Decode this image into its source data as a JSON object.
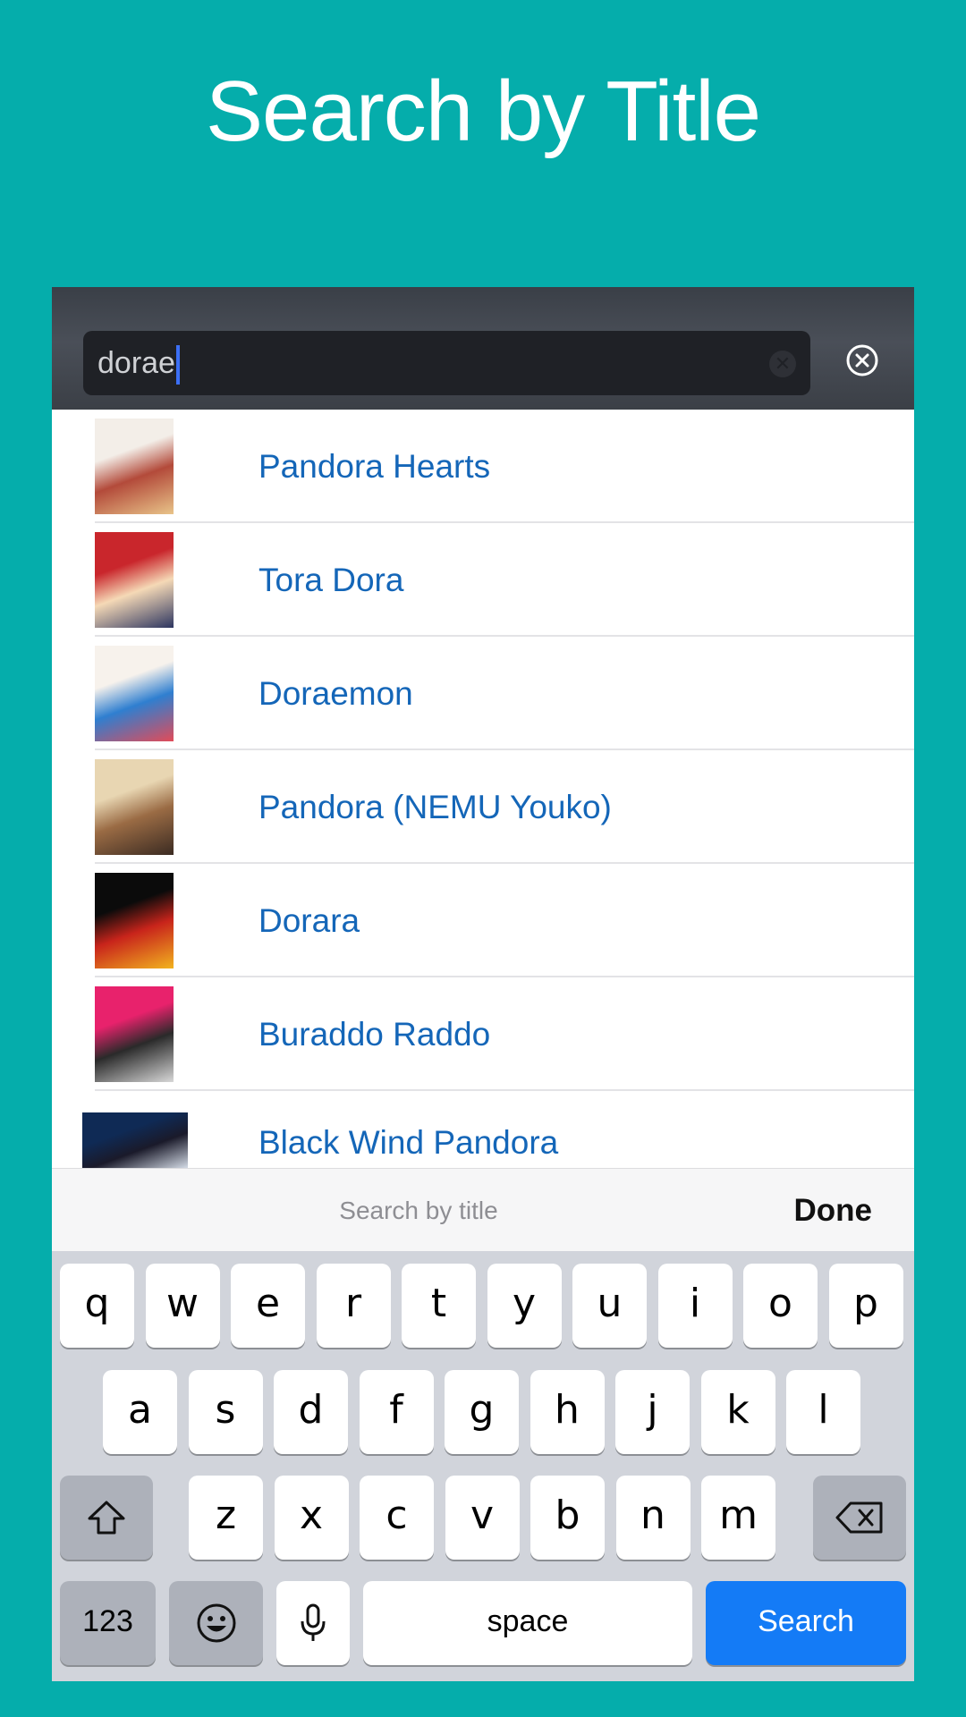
{
  "headline": "Search by Title",
  "search": {
    "query": "dorae"
  },
  "results": [
    {
      "title": "Pandora Hearts",
      "thumb_colors": [
        "#f3eee8",
        "#b34a3a",
        "#e8c489"
      ]
    },
    {
      "title": "Tora Dora",
      "thumb_colors": [
        "#c9262c",
        "#f5d9b6",
        "#2c3560"
      ]
    },
    {
      "title": "Doraemon",
      "thumb_colors": [
        "#f7f2ec",
        "#2f7fd0",
        "#e24b58"
      ]
    },
    {
      "title": "Pandora (NEMU Youko)",
      "thumb_colors": [
        "#e8d6b2",
        "#9a6b44",
        "#3b2b22"
      ]
    },
    {
      "title": "Dorara",
      "thumb_colors": [
        "#0b0b0b",
        "#c8241b",
        "#f2b31f"
      ]
    },
    {
      "title": "Buraddo Raddo",
      "thumb_colors": [
        "#e8226c",
        "#2a2a2a",
        "#d8d8d8"
      ]
    },
    {
      "title": "Black Wind Pandora",
      "thumb_colors": [
        "#0f2a55",
        "#1a1a2a",
        "#e6eef8"
      ]
    }
  ],
  "keyboard_bar": {
    "hint": "Search by title",
    "done_label": "Done"
  },
  "keyboard": {
    "row1": [
      "q",
      "w",
      "e",
      "r",
      "t",
      "y",
      "u",
      "i",
      "o",
      "p"
    ],
    "row2": [
      "a",
      "s",
      "d",
      "f",
      "g",
      "h",
      "j",
      "k",
      "l"
    ],
    "row3": [
      "z",
      "x",
      "c",
      "v",
      "b",
      "n",
      "m"
    ],
    "numbers_label": "123",
    "space_label": "space",
    "search_label": "Search"
  },
  "colors": {
    "background": "#05ADAB",
    "link": "#1466b8",
    "search_key": "#147bf6"
  }
}
